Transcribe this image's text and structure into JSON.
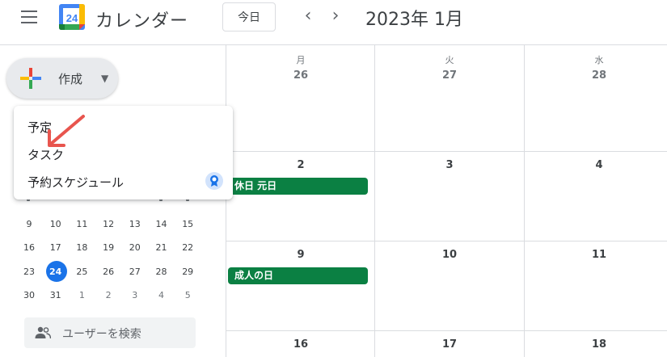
{
  "header": {
    "app_title": "カレンダー",
    "logo_day": "24",
    "today_label": "今日",
    "prev_icon": "chevron-left-icon",
    "next_icon": "chevron-right-icon",
    "month_title": "2023年 1月"
  },
  "create": {
    "label": "作成",
    "menu": [
      "予定",
      "タスク",
      "予約スケジュール"
    ],
    "badge_icon": "premium-badge-icon"
  },
  "mini_calendar": {
    "today": "24",
    "rows": [
      [
        "9",
        "10",
        "11",
        "12",
        "13",
        "14",
        "15"
      ],
      [
        "16",
        "17",
        "18",
        "19",
        "20",
        "21",
        "22"
      ],
      [
        "23",
        "24",
        "25",
        "26",
        "27",
        "28",
        "29"
      ],
      [
        "30",
        "31",
        "1",
        "2",
        "3",
        "4",
        "5"
      ]
    ]
  },
  "search_users": {
    "placeholder": "ユーザーを検索",
    "icon": "people-icon"
  },
  "grid": {
    "dow": [
      "月",
      "火",
      "水"
    ],
    "weeks": [
      [
        "26",
        "27",
        "28"
      ],
      [
        "2",
        "3",
        "4"
      ],
      [
        "9",
        "10",
        "11"
      ],
      [
        "16",
        "17",
        "18"
      ]
    ],
    "events": [
      "休日 元日",
      "成人の日"
    ]
  },
  "colors": {
    "event": "#0b8043",
    "accent": "#1a73e8"
  }
}
